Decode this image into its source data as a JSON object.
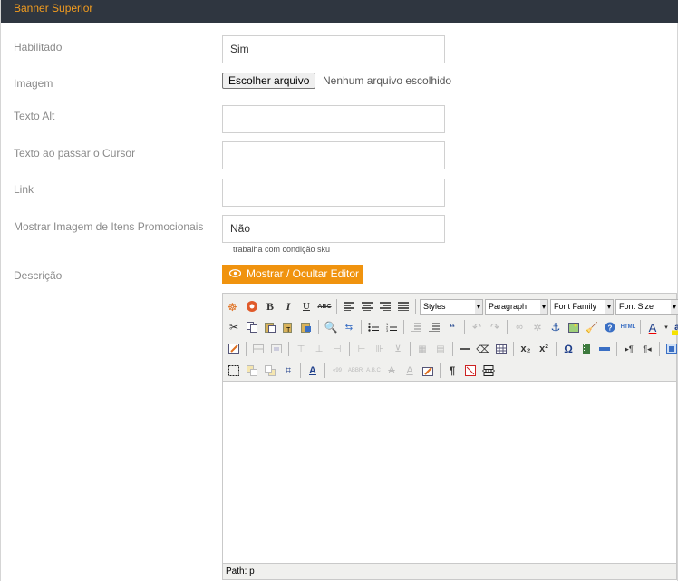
{
  "header": {
    "title": "Banner Superior"
  },
  "form": {
    "enabled": {
      "label": "Habilitado",
      "value": "Sim"
    },
    "image": {
      "label": "Imagem",
      "button": "Escolher arquivo",
      "status": "Nenhum arquivo escolhido"
    },
    "alt_text": {
      "label": "Texto Alt",
      "value": ""
    },
    "hover_text": {
      "label": "Texto ao passar o Cursor",
      "value": ""
    },
    "link": {
      "label": "Link",
      "value": ""
    },
    "promo": {
      "label": "Mostrar Imagem de Itens Promocionais",
      "value": "Não",
      "hint": "trabalha com condição sku"
    },
    "description": {
      "label": "Descrição",
      "toggle_button": "Mostrar / Ocultar Editor"
    }
  },
  "editor": {
    "styles": "Styles",
    "format": "Paragraph",
    "font_family": "Font Family",
    "font_size": "Font Size",
    "path": "Path: p"
  },
  "colors": {
    "accent": "#f0930e",
    "header_bg": "#2f3640",
    "header_text": "#f29c1f"
  }
}
